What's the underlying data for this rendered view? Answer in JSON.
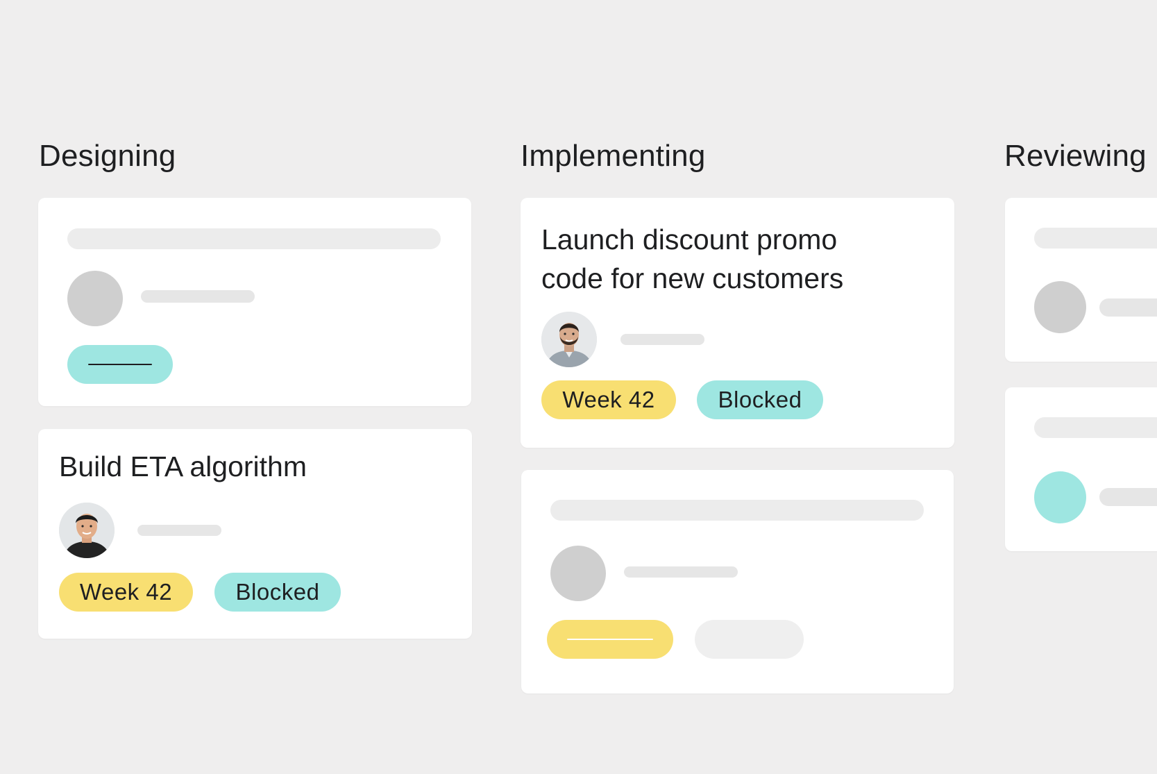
{
  "columns": [
    {
      "title": "Designing"
    },
    {
      "title": "Implementing"
    },
    {
      "title": "Reviewing"
    }
  ],
  "designing": {
    "task": {
      "title": "Build ETA algorithm",
      "avatar_icon": "person-avatar-icon",
      "tags": [
        "Week 42",
        "Blocked"
      ]
    }
  },
  "implementing": {
    "task": {
      "title_line1": "Launch discount promo",
      "title_line2": "code for new customers",
      "avatar_icon": "person-avatar-icon",
      "tags": [
        "Week 42",
        "Blocked"
      ]
    }
  },
  "colors": {
    "background": "#efeeee",
    "card": "#ffffff",
    "yellow_tag": "#f8df72",
    "teal_tag": "#9ee6e1",
    "placeholder": "#ececec",
    "placeholder_avatar": "#cfcfcf",
    "text": "#1e1f21"
  }
}
